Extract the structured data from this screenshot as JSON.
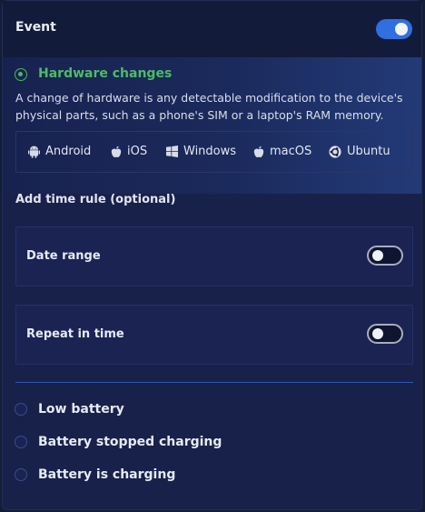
{
  "header": {
    "title": "Event",
    "toggle_on": true
  },
  "hardware": {
    "label": "Hardware changes",
    "selected": true,
    "description": "A change of hardware is any detectable modification to the device's physical parts, such as a phone's SIM or a laptop's RAM memory.",
    "platforms": [
      {
        "label": "Android",
        "icon": "android-icon"
      },
      {
        "label": "iOS",
        "icon": "apple-icon"
      },
      {
        "label": "Windows",
        "icon": "windows-icon"
      },
      {
        "label": "macOS",
        "icon": "apple-icon"
      },
      {
        "label": "Ubuntu",
        "icon": "ubuntu-icon"
      }
    ]
  },
  "time_rule": {
    "heading": "Add time rule (optional)",
    "date_range": {
      "label": "Date range",
      "enabled": false
    },
    "repeat": {
      "label": "Repeat in time",
      "enabled": false
    }
  },
  "options": [
    {
      "label": "Low battery",
      "selected": false
    },
    {
      "label": "Battery stopped charging",
      "selected": false
    },
    {
      "label": "Battery is charging",
      "selected": false
    }
  ],
  "colors": {
    "accent_green": "#49b95d",
    "toggle_blue": "#2f6fe0",
    "divider_blue": "#2f55b8",
    "panel_bg": "#18214a"
  }
}
